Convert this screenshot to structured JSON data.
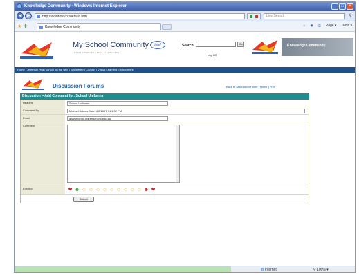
{
  "window": {
    "title": "Knowledge Community - Windows Internet Explorer",
    "min_glyph": "_",
    "max_glyph": "□",
    "close_glyph": "×"
  },
  "address": {
    "url": "http://localhost/cc/default.htm",
    "search_placeholder": "Live Search"
  },
  "toolbar": {
    "tab_label": "Knowledge Community",
    "page_label": "Page ▾",
    "tools_label": "Tools ▾"
  },
  "header": {
    "title": "My School Community",
    "subtitle": "learn | collaborate | share   in partnership",
    "intel": "intel",
    "search_label": "Search",
    "go_label": "Go",
    "logout": "Log Off",
    "banner": "Knowledge Community"
  },
  "nav": {
    "text": "Home | Jefferson High School on the web | Newsletter | Contact | Virtual Learning Environment"
  },
  "forum": {
    "title": "Discussion Forums",
    "links": "Back to Discussion Home | Home | Print"
  },
  "form": {
    "header": "Discussion > Add Comment for: School Uniforms",
    "heading_label": "Heading",
    "heading_value": "School Uniforms",
    "comment_by_label": "Comment By",
    "comment_by_value": "Michael Adams Date: 4/8/2007 9:21:32 PM",
    "email_label": "Email",
    "email_value": "adamsi@loc.clarendon.vic.edu.au",
    "comment_label": "Comment",
    "emotion_label": "Emotion",
    "emotions": [
      "❤",
      "☻",
      "☺",
      "☺",
      "☺",
      "☺",
      "☺",
      "☺",
      "☺",
      "☺",
      "☺",
      "☻",
      "❤"
    ],
    "submit_label": "Submit"
  },
  "status": {
    "zone": "Internet",
    "zoom": "100%"
  },
  "colors": {
    "nav_bar": "#1f4f8a",
    "form_header": "#1f8d8d",
    "forum_title": "#1f5fa8",
    "label_cell": "#ecead8"
  }
}
